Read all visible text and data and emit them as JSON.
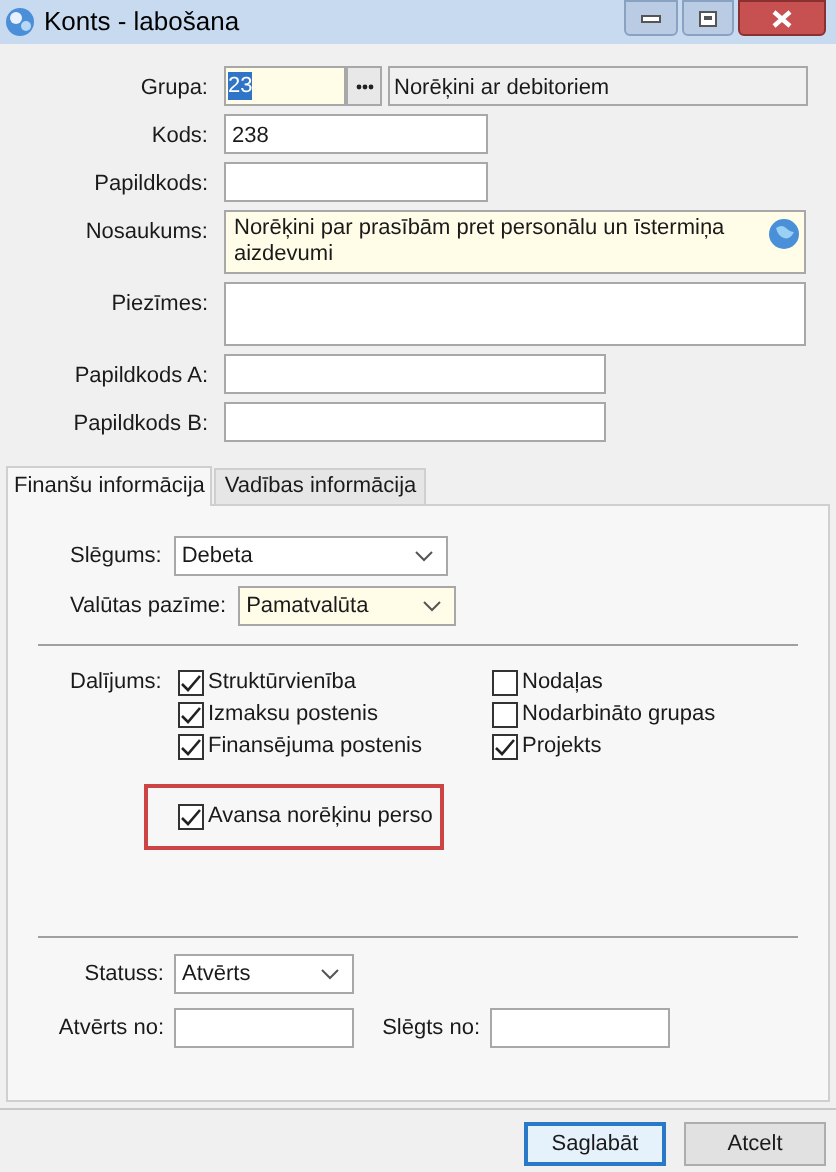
{
  "window": {
    "title": "Konts - labošana"
  },
  "form": {
    "fields": [
      {
        "kind": "lookup",
        "label": "Grupa:",
        "value": "23",
        "highlighted": true,
        "required": true,
        "description": "Norēķini ar debitoriem"
      },
      {
        "kind": "short",
        "label": "Kods:",
        "value": "238",
        "required": false
      },
      {
        "kind": "short",
        "label": "Papildkods:",
        "required": false
      },
      {
        "kind": "multiline",
        "label": "Nosaukums:",
        "value": "Norēķini par prasībām pret personālu un īstermiņa aizdevumi",
        "required": true,
        "globe": true
      },
      {
        "kind": "multiline",
        "label": "Piezīmes:",
        "required": false,
        "globe": false
      },
      {
        "kind": "long",
        "label": "Papildkods A:",
        "required": false
      },
      {
        "kind": "long",
        "label": "Papildkods B:",
        "required": false
      }
    ]
  },
  "tabs": [
    {
      "label": "Finanšu informācija",
      "selected": true
    },
    {
      "label": "Vadības informācija",
      "selected": false
    }
  ],
  "panel": {
    "combos": [
      {
        "label": "Slēgums:",
        "value": "Debeta",
        "required": false
      },
      {
        "label": "Valūtas pazīme:",
        "value": "Pamatvalūta",
        "required": true
      }
    ],
    "split": {
      "label": "Dalījums:",
      "columns": [
        [
          {
            "label": "Struktūrvienība",
            "checked": true
          },
          {
            "label": "Izmaksu postenis",
            "checked": true
          },
          {
            "label": "Finansējuma postenis",
            "checked": true
          }
        ],
        [
          {
            "label": "Nodaļas",
            "checked": false
          },
          {
            "label": "Nodarbināto grupas",
            "checked": false
          },
          {
            "label": "Projekts",
            "checked": true
          }
        ]
      ]
    },
    "callout": {
      "label": "Avansa norēķinu perso",
      "checked": true
    },
    "status": {
      "label": "Statuss:",
      "value": "Atvērts"
    },
    "dates": [
      {
        "label": "Atvērts no:"
      },
      {
        "label": "Slēgts no:"
      }
    ]
  },
  "buttons": [
    {
      "label": "Saglabāt",
      "primary": true
    },
    {
      "label": "Atcelt",
      "primary": false
    }
  ]
}
